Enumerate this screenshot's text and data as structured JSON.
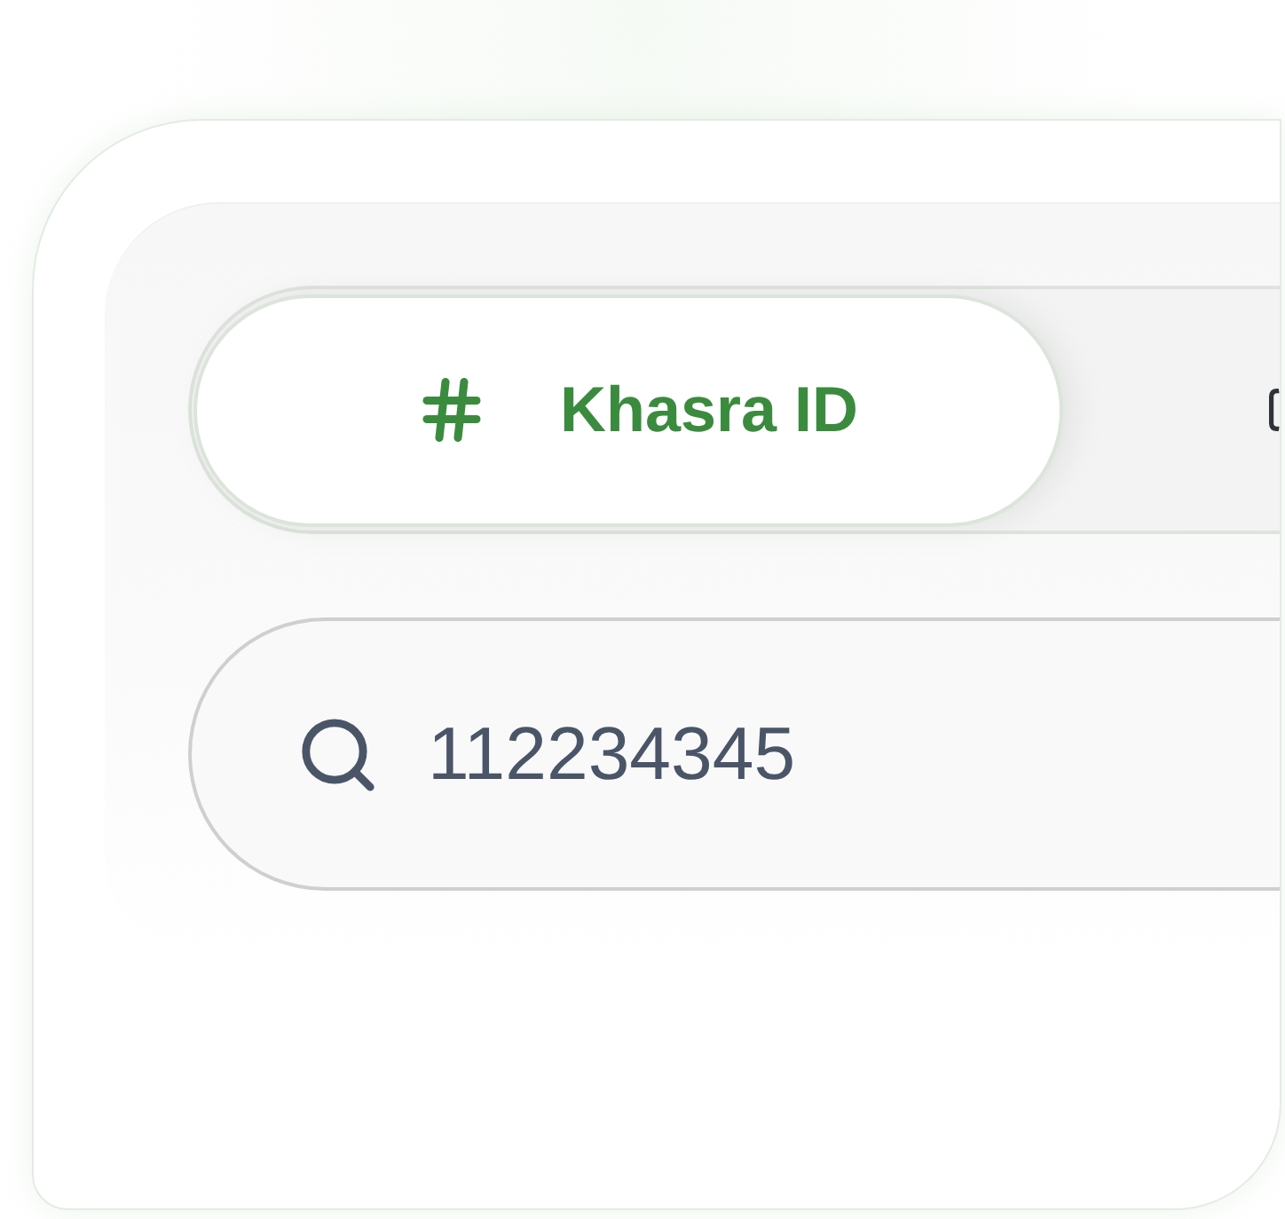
{
  "tabs": [
    {
      "label": "Khasra ID",
      "selected": true
    },
    {
      "selected": false
    }
  ],
  "search": {
    "value": "112234345"
  }
}
